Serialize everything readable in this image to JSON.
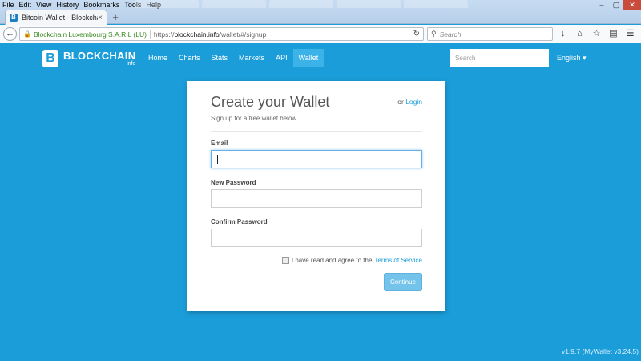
{
  "browser": {
    "menu": [
      "File",
      "Edit",
      "View",
      "History",
      "Bookmarks",
      "Tools",
      "Help"
    ],
    "tab_title": "Bitcoin Wallet - Blockchain",
    "tab_close": "×",
    "new_tab": "+",
    "url_org": "Blockchain Luxembourg S.A.R.L (LU)",
    "url_prefix": "https://",
    "url_host": "blockchain.info",
    "url_path": "/wallet/#/signup",
    "search_placeholder": "Search",
    "window_controls": [
      "–",
      "▢",
      "✕"
    ]
  },
  "site": {
    "logo_text": "BLOCKCHAIN",
    "logo_sub": "info",
    "nav": [
      "Home",
      "Charts",
      "Stats",
      "Markets",
      "API",
      "Wallet"
    ],
    "active_nav": "Wallet",
    "search_placeholder": "Search",
    "language": "English"
  },
  "form": {
    "title": "Create your Wallet",
    "or_text": "or",
    "login_link": "Login",
    "subtitle": "Sign up for a free wallet below",
    "email_label": "Email",
    "email_value": "",
    "password_label": "New Password",
    "confirm_label": "Confirm Password",
    "agree_text": "I have read and agree to the",
    "terms_link": "Terms of Service",
    "continue_label": "Continue"
  },
  "footer": {
    "version": "v1.9.7  (MyWallet v3.24.5)"
  },
  "colors": {
    "brand": "#1b9dd9",
    "active_nav": "#3bb2e8",
    "button": "#73c3ea"
  }
}
